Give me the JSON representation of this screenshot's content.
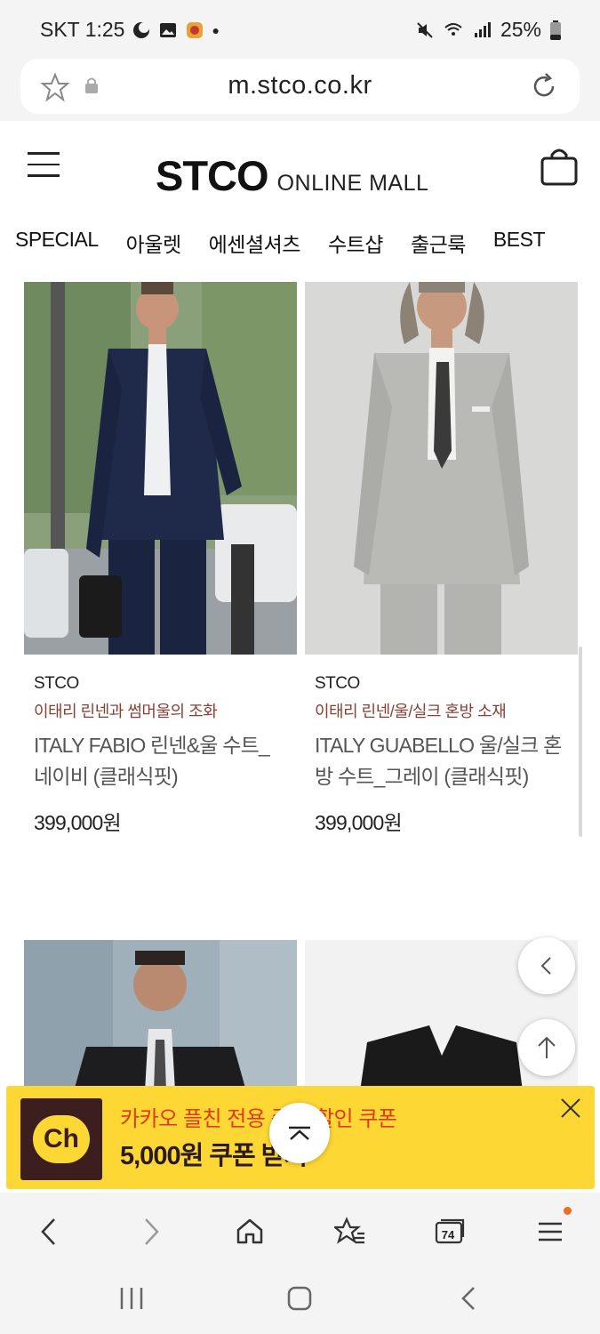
{
  "status": {
    "carrier_time": "SKT 1:25",
    "battery": "25%",
    "icons": [
      "moon-icon",
      "image-icon",
      "app-icon",
      "mute-icon",
      "wifi-icon",
      "signal-icon",
      "battery-icon"
    ]
  },
  "browser": {
    "url": "m.stco.co.kr",
    "tab_count": "74"
  },
  "header": {
    "logo_main": "STCO",
    "logo_sub": "ONLINE MALL"
  },
  "nav": {
    "items": [
      "SPECIAL",
      "아울렛",
      "에센셜셔츠",
      "수트샵",
      "출근룩",
      "BEST"
    ]
  },
  "products": [
    {
      "brand": "STCO",
      "desc": "이태리 린넨과 썸머울의 조화",
      "name": "ITALY FABIO 린넨&울 수트_네이비 (클래식핏)",
      "price": "399,000원"
    },
    {
      "brand": "STCO",
      "desc": "이태리 린넨/울/실크 혼방 소재",
      "name": "ITALY GUABELLO 울/실크 혼방 수트_그레이 (클래식핏)",
      "price": "399,000원"
    }
  ],
  "banner": {
    "logo_text": "Ch",
    "title": "카카오 플친 전용 즉시 할인 쿠폰",
    "subtitle": "5,000원 쿠폰 받기"
  },
  "colors": {
    "banner_bg": "#fdd835",
    "banner_title": "#e03a1c",
    "desc_text": "#8a3f34",
    "chrome_bg": "#f4f4f4"
  }
}
